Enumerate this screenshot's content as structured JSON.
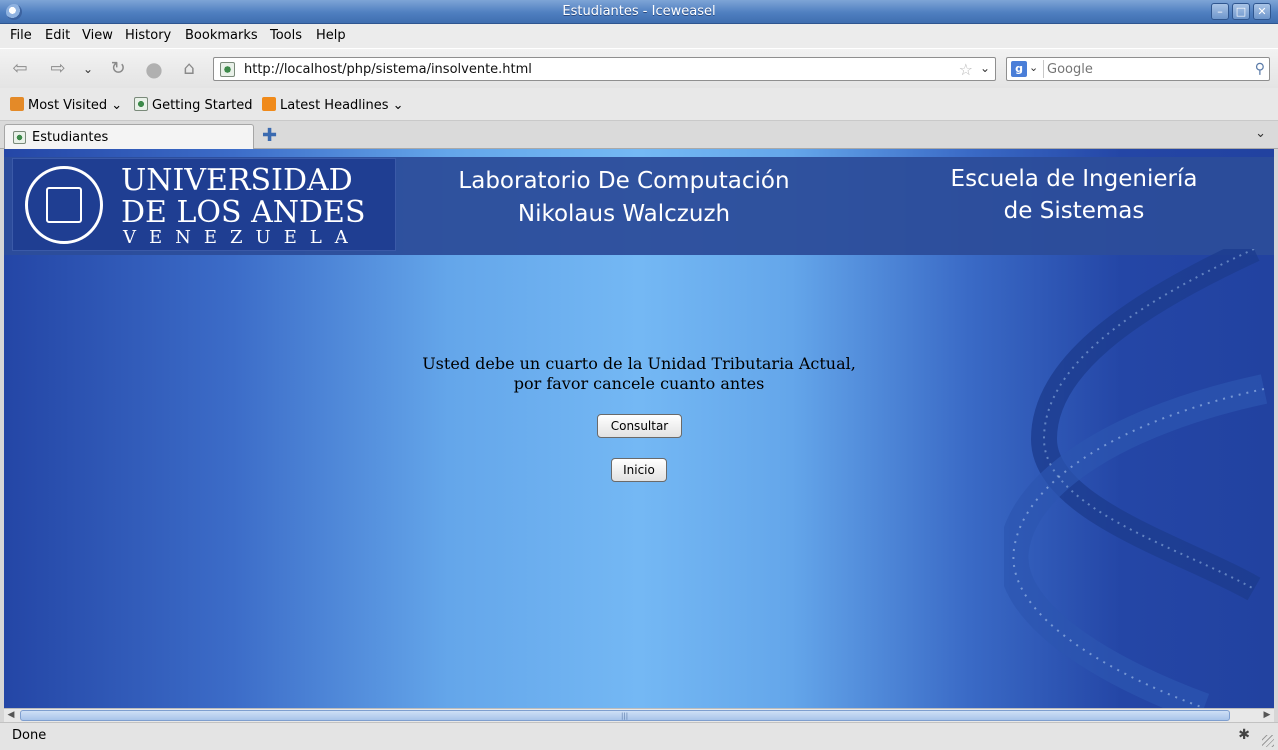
{
  "window": {
    "title": "Estudiantes - Iceweasel",
    "controls": {
      "minimize": "–",
      "maximize": "□",
      "close": "✕"
    }
  },
  "menu": [
    "File",
    "Edit",
    "View",
    "History",
    "Bookmarks",
    "Tools",
    "Help"
  ],
  "navigation": {
    "back_icon": "back-arrow-icon",
    "forward_icon": "forward-arrow-icon",
    "url": "http://localhost/php/sistema/insolvente.html",
    "search_placeholder": "Google"
  },
  "bookmarks": [
    {
      "label": "Most Visited",
      "icon": "most-visited-icon",
      "dropdown": true
    },
    {
      "label": "Getting Started",
      "icon": "page-icon",
      "dropdown": false
    },
    {
      "label": "Latest Headlines",
      "icon": "rss-feed-icon",
      "dropdown": true
    }
  ],
  "tabs": [
    {
      "label": "Estudiantes",
      "active": true
    }
  ],
  "page": {
    "logo": {
      "line1": "UNIVERSIDAD",
      "line2": "DE LOS ANDES",
      "line3": "VENEZUELA"
    },
    "lab_title": {
      "line1": "Laboratorio De Computación",
      "line2": "Nikolaus Walczuzh"
    },
    "school_title": {
      "line1": "Escuela de Ingeniería",
      "line2": "de Sistemas"
    },
    "message": {
      "line1": "Usted debe un cuarto de la Unidad Tributaria Actual,",
      "line2": "por favor cancele cuanto antes"
    },
    "buttons": {
      "consultar": "Consultar",
      "inicio": "Inicio"
    }
  },
  "status": "Done",
  "colors": {
    "titlebar": "#4f7fc0",
    "page_dark_blue": "#2446a6",
    "page_light_blue": "#74b8f4",
    "header_band": "#2c4d9a"
  }
}
